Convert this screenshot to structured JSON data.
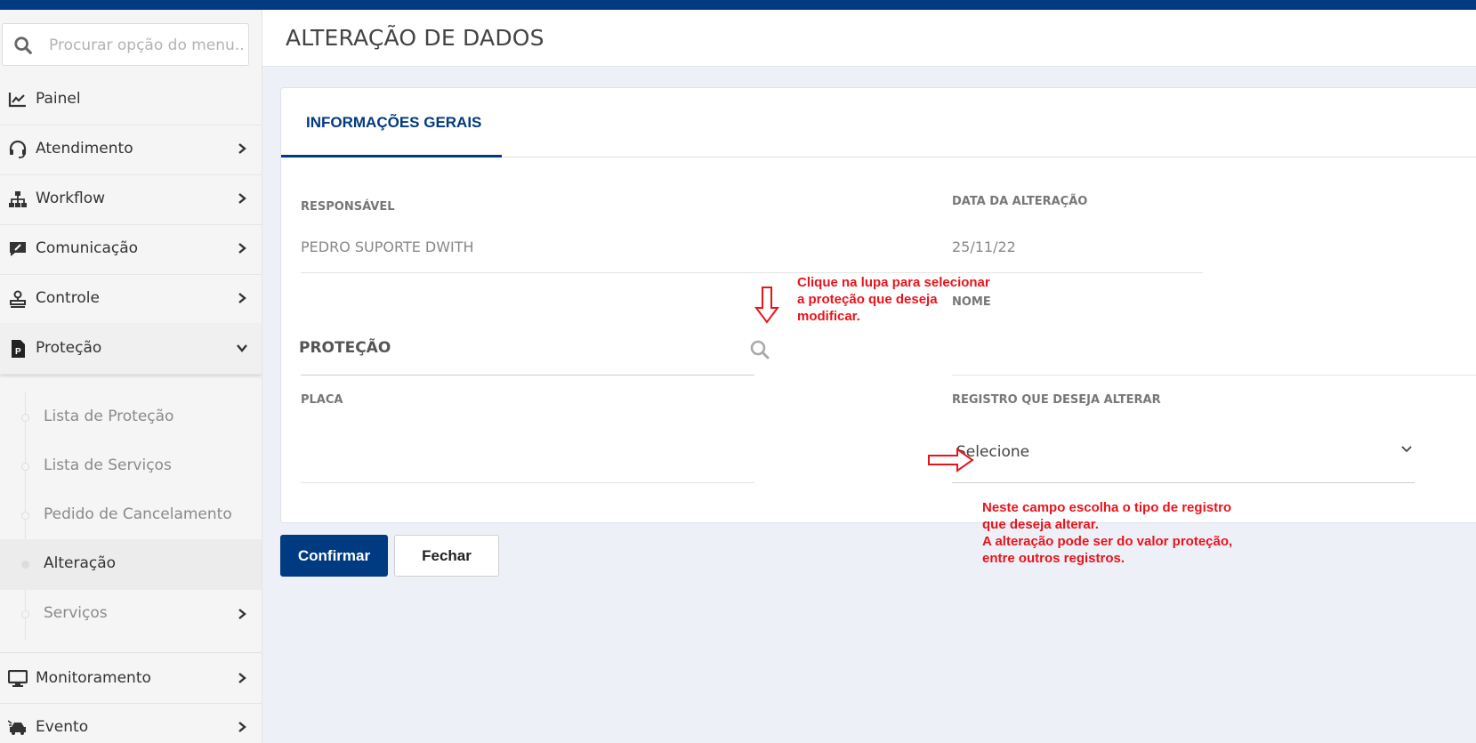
{
  "sidebar": {
    "search_placeholder": "Procurar opção do menu...",
    "items": [
      {
        "label": "Painel",
        "icon": "chart-line-icon",
        "has_chevron": false
      },
      {
        "label": "Atendimento",
        "icon": "headset-icon",
        "has_chevron": true
      },
      {
        "label": "Workflow",
        "icon": "sitemap-icon",
        "has_chevron": true
      },
      {
        "label": "Comunicação",
        "icon": "comment-edit-icon",
        "has_chevron": true
      },
      {
        "label": "Controle",
        "icon": "stamp-icon",
        "has_chevron": true
      },
      {
        "label": "Proteção",
        "icon": "file-p-icon",
        "has_chevron": true,
        "expanded": true
      },
      {
        "label": "Monitoramento",
        "icon": "monitor-icon",
        "has_chevron": true
      },
      {
        "label": "Evento",
        "icon": "car-crash-icon",
        "has_chevron": true
      }
    ],
    "protecao_subitems": [
      {
        "label": "Lista de Proteção"
      },
      {
        "label": "Lista de Serviços"
      },
      {
        "label": "Pedido de Cancelamento"
      },
      {
        "label": "Alteração",
        "active": true
      },
      {
        "label": "Serviços",
        "has_chevron": true
      }
    ]
  },
  "header": {
    "title": "ALTERAÇÃO DE DADOS"
  },
  "card": {
    "tab_label": "INFORMAÇÕES GERAIS",
    "fields": {
      "responsavel_label": "RESPONSÁVEL",
      "responsavel_value": "PEDRO SUPORTE DWITH",
      "data_label": "DATA DA ALTERAÇÃO",
      "data_value": "25/11/22",
      "protecao_label": "PROTEÇÃO",
      "nome_label": "NOME",
      "placa_label": "PLACA",
      "registro_label": "REGISTRO QUE DESEJA ALTERAR",
      "registro_value": "Selecione"
    }
  },
  "buttons": {
    "confirm": "Confirmar",
    "close": "Fechar"
  },
  "annotations": {
    "lupa_line1": "Clique na lupa para selecionar",
    "lupa_line2": "a proteção que deseja",
    "lupa_line3": "modificar.",
    "registro_line1": "Neste campo escolha o tipo de registro",
    "registro_line2": "que deseja alterar.",
    "registro_line3": "A alteração pode ser do valor proteção,",
    "registro_line4": "entre outros registros."
  },
  "colors": {
    "brand": "#003a80",
    "annotation": "#e8141c"
  }
}
